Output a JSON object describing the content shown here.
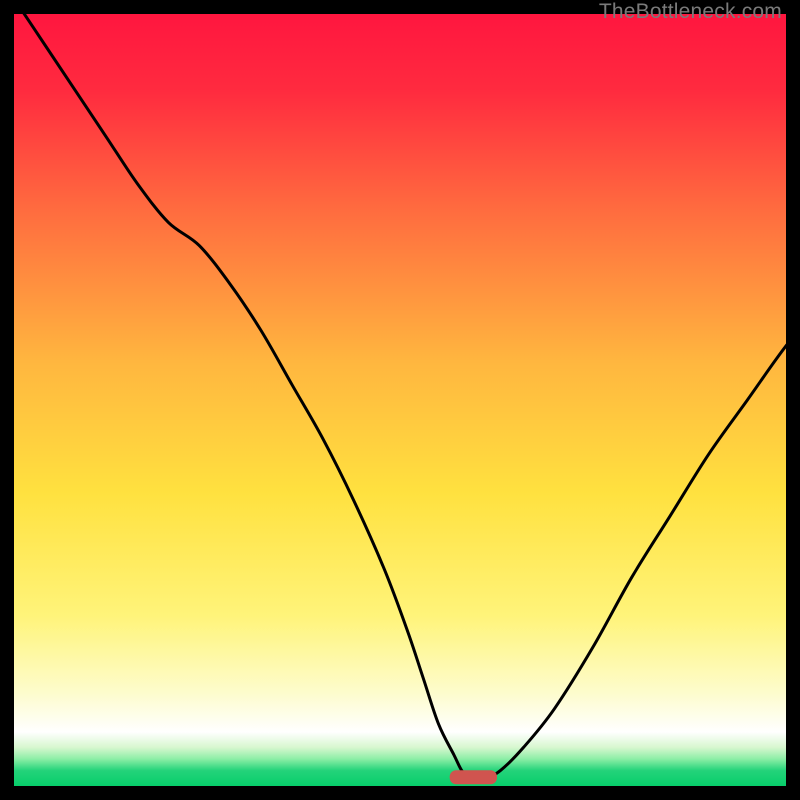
{
  "watermark": "TheBottleneck.com",
  "colors": {
    "gradient_top": "#ff1744",
    "gradient_mid_upper": "#ff6e40",
    "gradient_mid": "#ffd740",
    "gradient_lower": "#fff59d",
    "gradient_white": "#ffffff",
    "gradient_bottom": "#00e676",
    "curve": "#000000",
    "marker_fill": "#d0544f",
    "marker_stroke": "#d0544f"
  },
  "chart_data": {
    "type": "line",
    "title": "",
    "xlabel": "",
    "ylabel": "",
    "xlim": [
      0,
      100
    ],
    "ylim": [
      0,
      100
    ],
    "series": [
      {
        "name": "bottleneck-curve",
        "x": [
          0,
          4,
          8,
          12,
          16,
          20,
          24,
          28,
          32,
          36,
          40,
          44,
          48,
          51,
          53,
          55,
          57,
          58,
          59,
          61,
          63,
          66,
          70,
          75,
          80,
          85,
          90,
          95,
          100,
          105
        ],
        "y": [
          102,
          96,
          90,
          84,
          78,
          73,
          70,
          65,
          59,
          52,
          45,
          37,
          28,
          20,
          14,
          8,
          4,
          2,
          1,
          1,
          2,
          5,
          10,
          18,
          27,
          35,
          43,
          50,
          57,
          63
        ]
      }
    ],
    "marker": {
      "x_center": 59.5,
      "width": 6,
      "y": 1.2
    }
  }
}
